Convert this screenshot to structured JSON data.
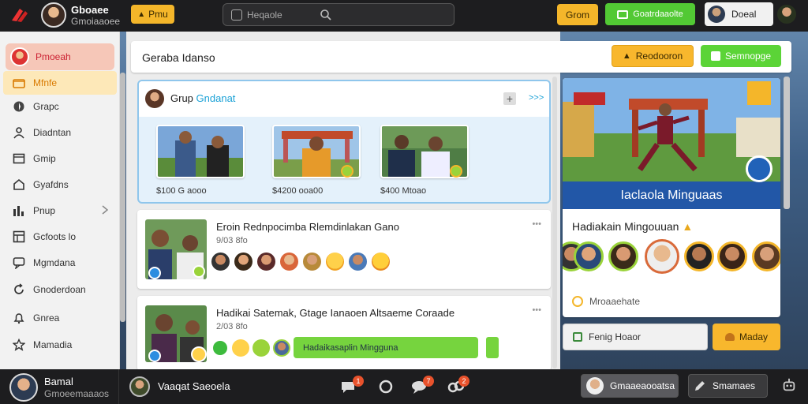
{
  "topbar": {
    "user_name": "Gboaee",
    "user_sub": "Gmoiaaoee",
    "orange_btn": "Pmu",
    "search_placeholder": "Heqaole",
    "grow_btn": "Grom",
    "green_btn": "Goatrdaaolte",
    "profile_btn": "Doeal"
  },
  "sidebar": {
    "header": "Pmoeah",
    "items": [
      {
        "label": "Mfnfe",
        "icon": "folder-icon",
        "active": true
      },
      {
        "label": "Grapc",
        "icon": "compass-icon"
      },
      {
        "label": "Diadntan",
        "icon": "person-icon"
      },
      {
        "label": "Gmip",
        "icon": "window-icon"
      },
      {
        "label": "Gyafdns",
        "icon": "home-icon"
      },
      {
        "label": "Pnup",
        "icon": "chart-icon"
      },
      {
        "label": "Gcfoots lo",
        "icon": "grid-icon"
      },
      {
        "label": "Mgmdana",
        "icon": "chat-icon"
      },
      {
        "label": "Gnoderdoan",
        "icon": "refresh-icon"
      },
      {
        "label": "Gnrea",
        "icon": "bell-icon"
      },
      {
        "label": "Mamadia",
        "icon": "star-icon"
      }
    ]
  },
  "header": {
    "title": "Geraba Idanso",
    "recommend_btn": "Reodooron",
    "share_btn": "Semnopge"
  },
  "group": {
    "title_prefix": "Grup",
    "title_accent": "Gndanat",
    "more": ">>>",
    "videos": [
      {
        "caption": "$100 G aooo"
      },
      {
        "caption": "$4200 ooa00"
      },
      {
        "caption": "$400 Mtoao"
      }
    ]
  },
  "posts": [
    {
      "title": "Eroin Rednpocimba Rlemdinlakan Gano",
      "sub": "9/03 8fo",
      "menu": "•••"
    },
    {
      "title": "Hadikai Satemak, Gtage Ianaoen Altsaeme Coraade",
      "sub": "2/03 8fo",
      "menu": "•••",
      "pill": "Hadaikasaplin Mingguna"
    }
  ],
  "right": {
    "hero_label": "Iaclaola Minguaas",
    "title": "Hadiakain Mingouuan",
    "footer": "Mroaaehate",
    "follow_btn": "Fenig Hoaor",
    "member_btn": "Maday"
  },
  "bottombar": {
    "user_name": "Bamal",
    "user_sub": "Gmoeemaaaos",
    "chat_title": "Vaaqat Saeoela",
    "notif": [
      "1",
      "7",
      "2"
    ],
    "btn1": "Gmaaeaooatsa",
    "btn2": "Smamaes"
  },
  "colors": {
    "accent_orange": "#f4b62a",
    "accent_green": "#52c934",
    "accent_blue": "#1aa1d6"
  }
}
